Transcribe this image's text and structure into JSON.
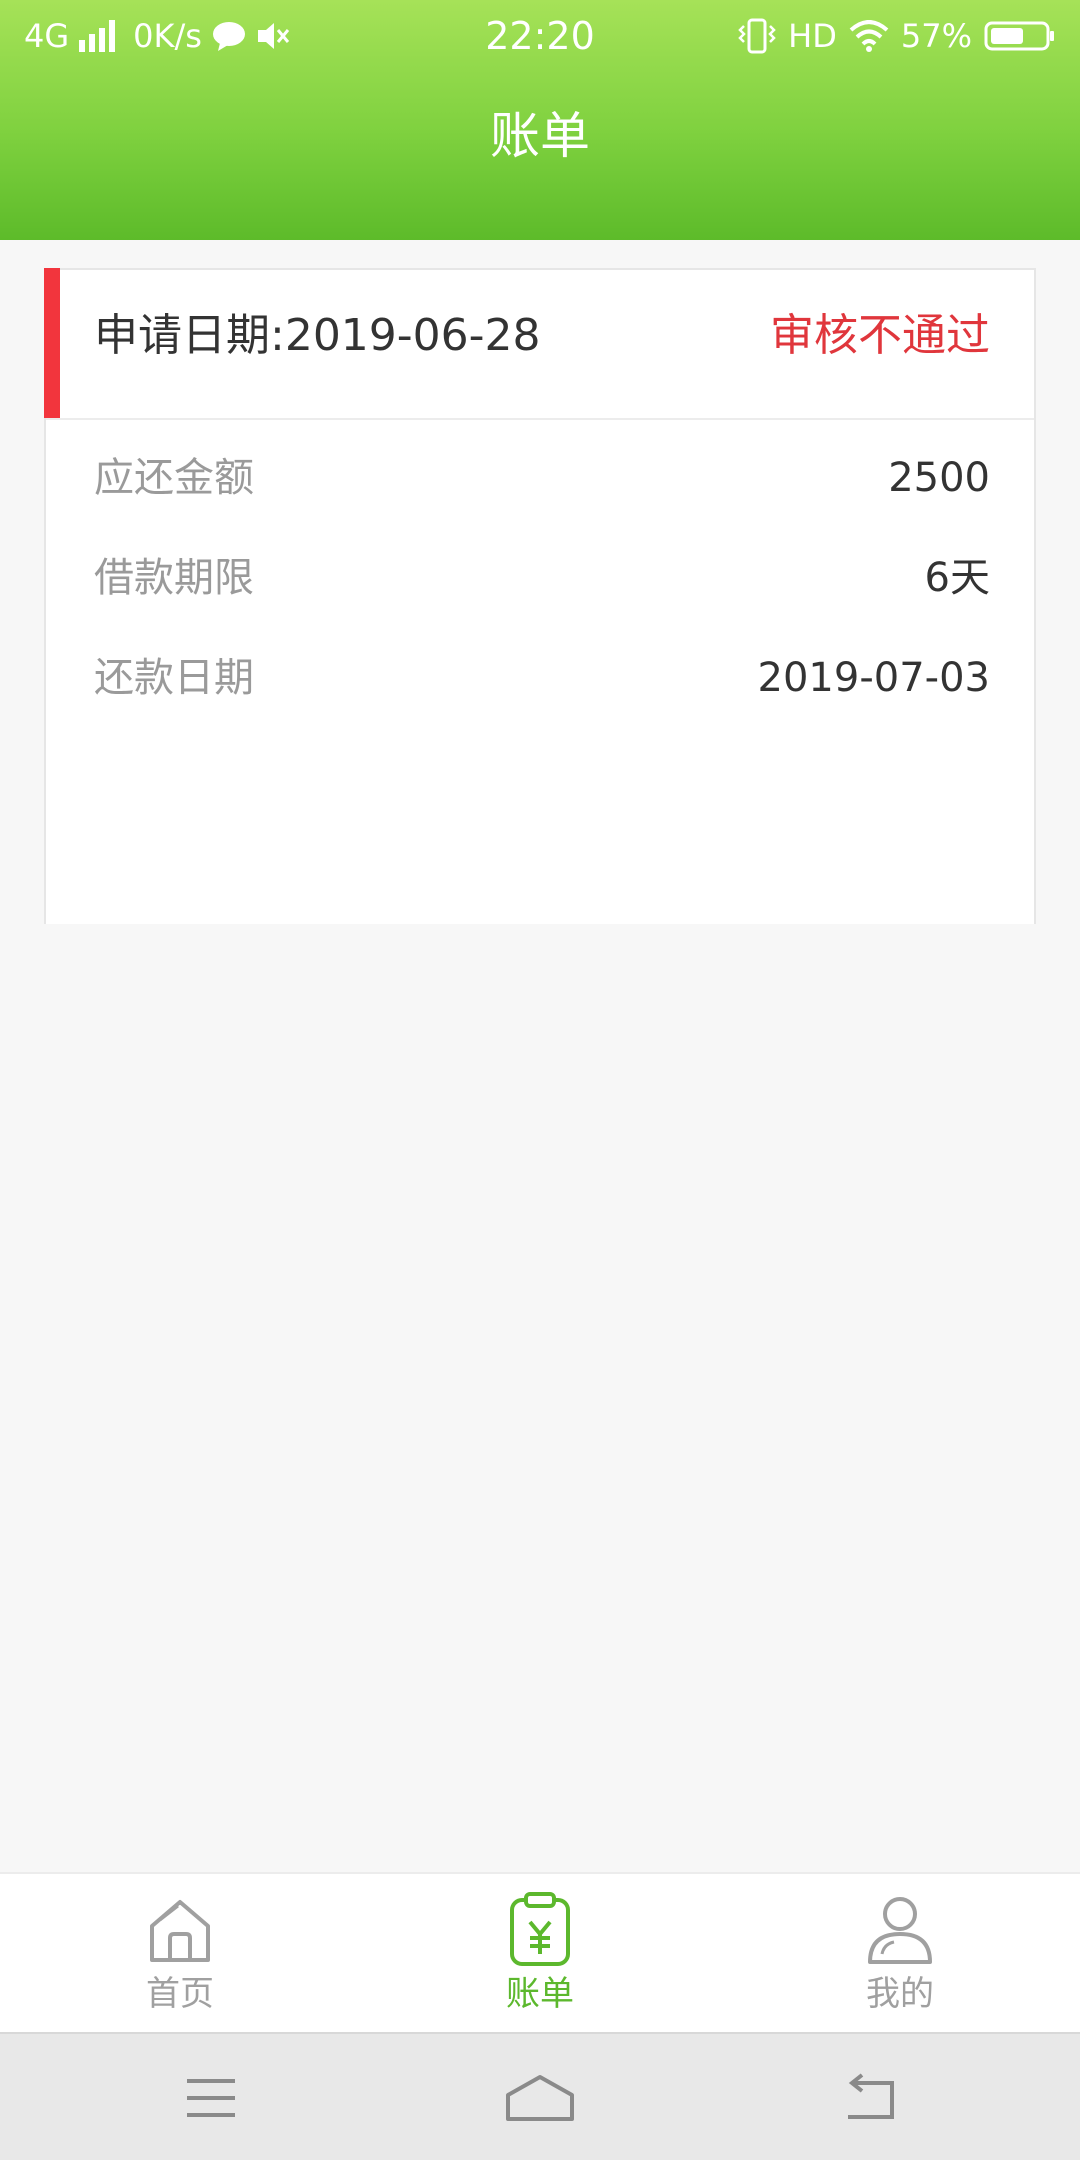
{
  "status_bar": {
    "network": "4G",
    "speed": "0K/s",
    "time": "22:20",
    "hd": "HD",
    "battery": "57%"
  },
  "header": {
    "title": "账单"
  },
  "bill": {
    "apply_date": "申请日期:2019-06-28",
    "status": "审核不通过",
    "accent_color": "#f2353d",
    "status_color": "#e0363c",
    "rows": [
      {
        "label": "应还金额",
        "value": "2500"
      },
      {
        "label": "借款期限",
        "value": "6天"
      },
      {
        "label": "还款日期",
        "value": "2019-07-03"
      }
    ]
  },
  "tabbar": {
    "active_color": "#5cb82d",
    "items": [
      {
        "label": "首页",
        "icon": "home-icon"
      },
      {
        "label": "账单",
        "icon": "bill-icon"
      },
      {
        "label": "我的",
        "icon": "user-icon"
      }
    ]
  },
  "system_nav": {
    "icons": [
      "menu-icon",
      "home-outline-icon",
      "back-icon"
    ]
  }
}
